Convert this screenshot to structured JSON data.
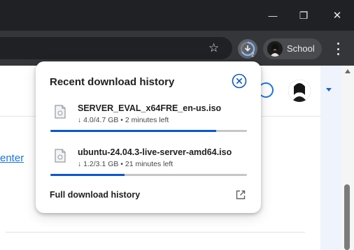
{
  "window": {
    "minimize_glyph": "—",
    "maximize_glyph": "❐",
    "close_glyph": "✕"
  },
  "toolbar": {
    "bookmark_glyph": "☆",
    "download_button_icon": "download-progress-icon",
    "profile_label": "School"
  },
  "page": {
    "link_text": "enter"
  },
  "popup": {
    "title": "Recent download history",
    "items": [
      {
        "name": "SERVER_EVAL_x64FRE_en-us.iso",
        "status": "↓ 4.0/4.7 GB • 2 minutes left",
        "progress": 0.845
      },
      {
        "name": "ubuntu-24.04.3-live-server-amd64.iso",
        "status": "↓ 1.2/3.1 GB • 21 minutes left",
        "progress": 0.376
      }
    ],
    "footer_label": "Full download history"
  },
  "colors": {
    "titlebar": "#202124",
    "toolbar": "#35363a",
    "accent": "#0b57d0",
    "link": "#1a73e8"
  }
}
